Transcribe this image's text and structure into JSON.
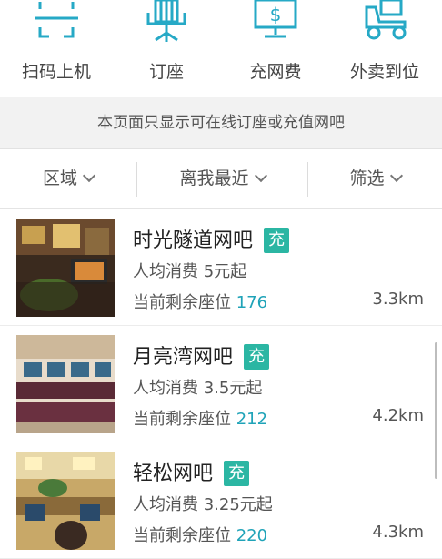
{
  "quick_actions": [
    {
      "label": "扫码上机",
      "icon": "scan-icon"
    },
    {
      "label": "订座",
      "icon": "chair-icon"
    },
    {
      "label": "充网费",
      "icon": "monitor-dollar-icon"
    },
    {
      "label": "外卖到位",
      "icon": "delivery-cart-icon"
    }
  ],
  "notice": "本页面只显示可在线订座或充值网吧",
  "filters": [
    {
      "label": "区域"
    },
    {
      "label": "离我最近"
    },
    {
      "label": "筛选"
    }
  ],
  "colors": {
    "accent": "#2bb6a3",
    "seat_count": "#1fa3b8",
    "icon": "#26a9c6"
  },
  "cafes": [
    {
      "name": "时光隧道网吧",
      "badge": "充",
      "price": "人均消费 5元起",
      "seats_label": "当前剩余座位",
      "seats": "176",
      "distance": "3.3km"
    },
    {
      "name": "月亮湾网吧",
      "badge": "充",
      "price": "人均消费 3.5元起",
      "seats_label": "当前剩余座位",
      "seats": "212",
      "distance": "4.2km"
    },
    {
      "name": "轻松网吧",
      "badge": "充",
      "price": "人均消费 3.25元起",
      "seats_label": "当前剩余座位",
      "seats": "220",
      "distance": "4.3km"
    }
  ]
}
